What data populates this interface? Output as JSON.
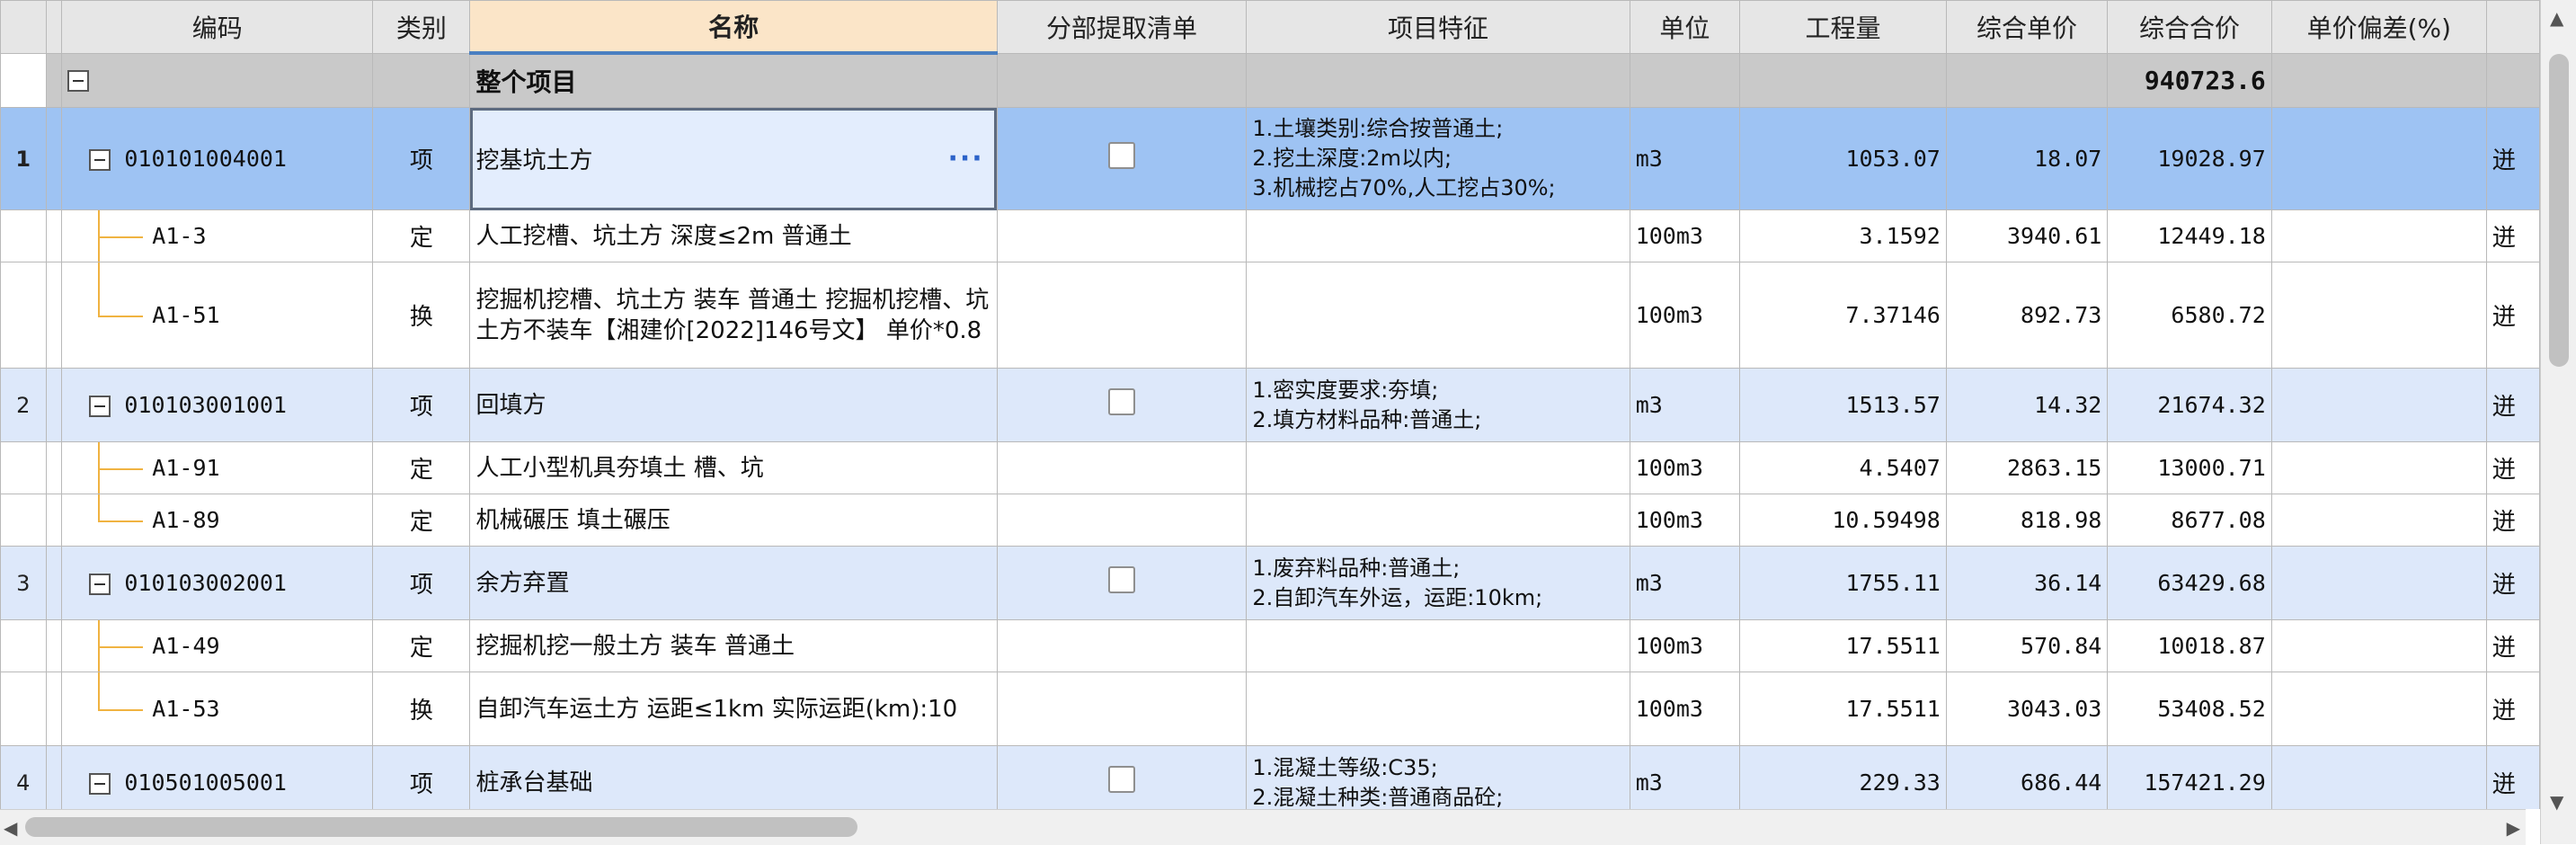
{
  "headers": {
    "code": "编码",
    "category": "类别",
    "name": "名称",
    "extract_list": "分部提取清单",
    "features": "项目特征",
    "unit": "单位",
    "quantity": "工程量",
    "unit_price": "综合单价",
    "total_price": "综合合价",
    "deviation": "单价偏差(%)"
  },
  "whole_project": {
    "name": "整个项目",
    "total_price": "940723.6"
  },
  "rows": [
    {
      "rownum": "1",
      "code": "010101004001",
      "category": "项",
      "name": "挖基坑土方",
      "features": "1.土壤类别:综合按普通土;\n2.挖土深度:2m以内;\n3.机械挖占70%,人工挖占30%;",
      "unit": "m3",
      "quantity": "1053.07",
      "unit_price": "18.07",
      "total_price": "19028.97",
      "edge": "迸"
    },
    {
      "rownum": "",
      "code": "A1-3",
      "category": "定",
      "name": "人工挖槽、坑土方 深度≤2m 普通土",
      "features": "",
      "unit": "100m3",
      "quantity": "3.1592",
      "unit_price": "3940.61",
      "total_price": "12449.18",
      "edge": "迸"
    },
    {
      "rownum": "",
      "code": "A1-51",
      "category": "换",
      "name": "挖掘机挖槽、坑土方 装车 普通土  挖掘机挖槽、坑土方不装车【湘建价[2022]146号文】 单价*0.8",
      "features": "",
      "unit": "100m3",
      "quantity": "7.37146",
      "unit_price": "892.73",
      "total_price": "6580.72",
      "edge": "迸"
    },
    {
      "rownum": "2",
      "code": "010103001001",
      "category": "项",
      "name": "回填方",
      "features": "1.密实度要求:夯填;\n2.填方材料品种:普通土;",
      "unit": "m3",
      "quantity": "1513.57",
      "unit_price": "14.32",
      "total_price": "21674.32",
      "edge": "迸"
    },
    {
      "rownum": "",
      "code": "A1-91",
      "category": "定",
      "name": "人工小型机具夯填土 槽、坑",
      "features": "",
      "unit": "100m3",
      "quantity": "4.5407",
      "unit_price": "2863.15",
      "total_price": "13000.71",
      "edge": "迸"
    },
    {
      "rownum": "",
      "code": "A1-89",
      "category": "定",
      "name": "机械碾压 填土碾压",
      "features": "",
      "unit": "100m3",
      "quantity": "10.59498",
      "unit_price": "818.98",
      "total_price": "8677.08",
      "edge": "迸"
    },
    {
      "rownum": "3",
      "code": "010103002001",
      "category": "项",
      "name": "余方弃置",
      "features": "1.废弃料品种:普通土;\n2.自卸汽车外运，运距:10km;",
      "unit": "m3",
      "quantity": "1755.11",
      "unit_price": "36.14",
      "total_price": "63429.68",
      "edge": "迸"
    },
    {
      "rownum": "",
      "code": "A1-49",
      "category": "定",
      "name": "挖掘机挖一般土方 装车 普通土",
      "features": "",
      "unit": "100m3",
      "quantity": "17.5511",
      "unit_price": "570.84",
      "total_price": "10018.87",
      "edge": "迸"
    },
    {
      "rownum": "",
      "code": "A1-53",
      "category": "换",
      "name": "自卸汽车运土方 运距≤1km  实际运距(km):10",
      "features": "",
      "unit": "100m3",
      "quantity": "17.5511",
      "unit_price": "3043.03",
      "total_price": "53408.52",
      "edge": "迸"
    },
    {
      "rownum": "4",
      "code": "010501005001",
      "category": "项",
      "name": "桩承台基础",
      "features": "1.混凝土等级:C35;\n2.混凝土种类:普通商品砼;",
      "unit": "m3",
      "quantity": "229.33",
      "unit_price": "686.44",
      "total_price": "157421.29",
      "edge": "迸"
    }
  ],
  "more_button": "···",
  "colors": {
    "selected_row": "#9ec3f3",
    "item_row": "#dde8fa",
    "header_active": "#fbe5c8",
    "tree_line": "#f0b341"
  }
}
